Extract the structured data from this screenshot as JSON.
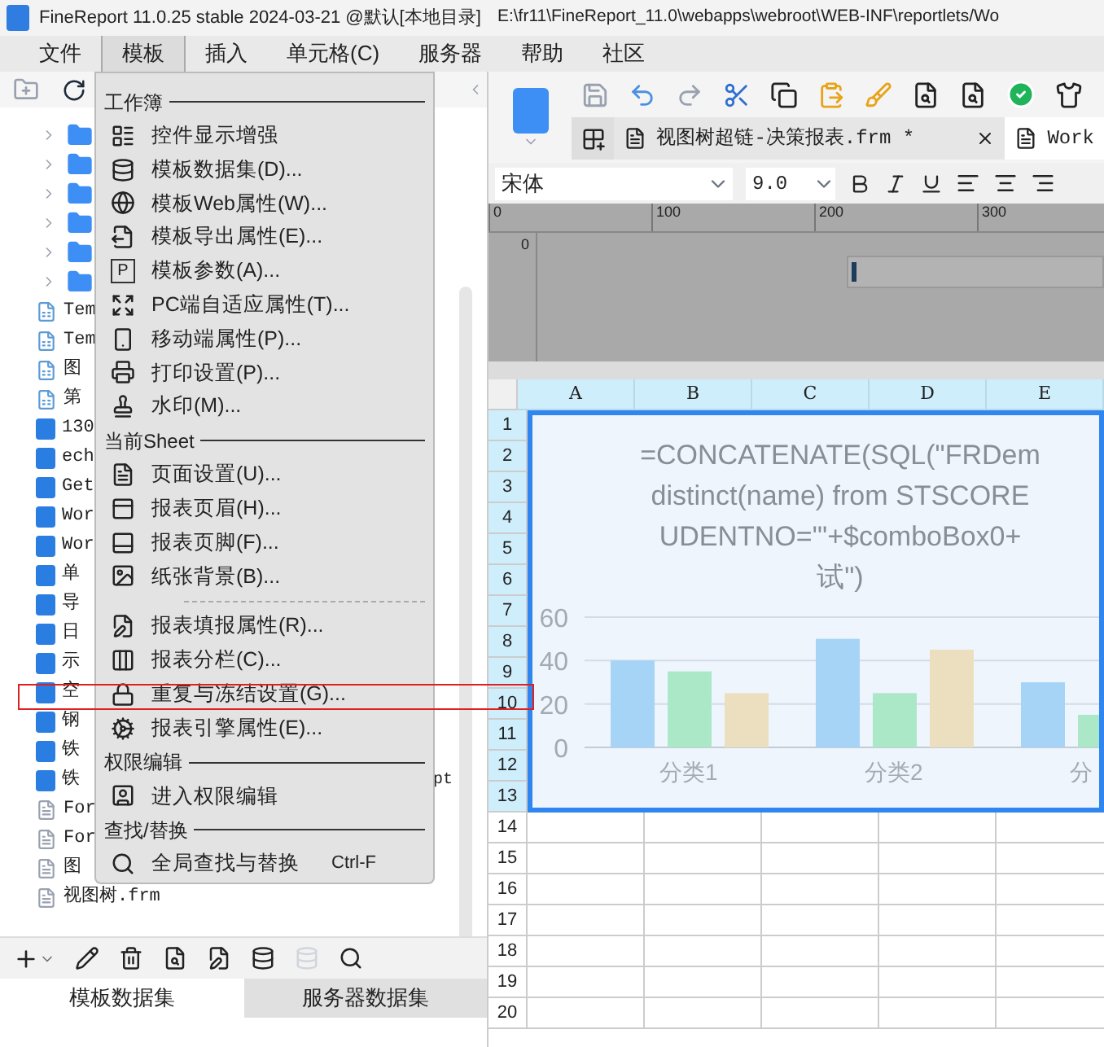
{
  "window": {
    "title": "FineReport 11.0.25 stable 2024-03-21 @默认[本地目录]",
    "path": "E:\\fr11\\FineReport_11.0\\webapps\\webroot\\WEB-INF\\reportlets/Wo"
  },
  "menubar": [
    {
      "label": "文件",
      "selected": false
    },
    {
      "label": "模板",
      "selected": true
    },
    {
      "label": "插入",
      "selected": false
    },
    {
      "label": "单元格(C)",
      "selected": false
    },
    {
      "label": "服务器",
      "selected": false
    },
    {
      "label": "帮助",
      "selected": false
    },
    {
      "label": "社区",
      "selected": false
    }
  ],
  "tree": [
    {
      "kind": "folder"
    },
    {
      "kind": "folder"
    },
    {
      "kind": "folder"
    },
    {
      "kind": "folder"
    },
    {
      "kind": "folder"
    },
    {
      "kind": "folder"
    },
    {
      "kind": "cpt",
      "label": "Tem"
    },
    {
      "kind": "cpt",
      "label": "Tem"
    },
    {
      "kind": "cpt",
      "label": "图"
    },
    {
      "kind": "cpt",
      "label": "第"
    },
    {
      "kind": "frm",
      "label": "130"
    },
    {
      "kind": "frm",
      "label": "ech"
    },
    {
      "kind": "frm",
      "label": "Get"
    },
    {
      "kind": "frm",
      "label": "Wor"
    },
    {
      "kind": "frm",
      "label": "Wor"
    },
    {
      "kind": "frm",
      "label": "单"
    },
    {
      "kind": "frm",
      "label": "导"
    },
    {
      "kind": "frm",
      "label": "日"
    },
    {
      "kind": "frm",
      "label": "示"
    },
    {
      "kind": "frm",
      "label": "空"
    },
    {
      "kind": "frm",
      "label": "钢"
    },
    {
      "kind": "frm",
      "label": "铁"
    },
    {
      "kind": "frm",
      "label": "铁",
      "tail": "pt"
    },
    {
      "kind": "form",
      "label": "For"
    },
    {
      "kind": "form",
      "label": "For"
    },
    {
      "kind": "form",
      "label": "图"
    },
    {
      "kind": "form",
      "label": "视图树.frm"
    }
  ],
  "dataset_tabs": [
    {
      "label": "模板数据集",
      "selected": true
    },
    {
      "label": "服务器数据集",
      "selected": false
    }
  ],
  "menu": [
    {
      "kind": "header",
      "label": "工作簿"
    },
    {
      "kind": "item",
      "label": "控件显示增强"
    },
    {
      "kind": "item",
      "label": "模板数据集(D)..."
    },
    {
      "kind": "item",
      "label": "模板Web属性(W)..."
    },
    {
      "kind": "item",
      "label": "模板导出属性(E)..."
    },
    {
      "kind": "item",
      "label": "模板参数(A)...",
      "glyph": "P"
    },
    {
      "kind": "item",
      "label": "PC端自适应属性(T)..."
    },
    {
      "kind": "item",
      "label": "移动端属性(P)..."
    },
    {
      "kind": "item",
      "label": "打印设置(P)..."
    },
    {
      "kind": "item",
      "label": "水印(M)..."
    },
    {
      "kind": "header",
      "label": "当前Sheet"
    },
    {
      "kind": "item",
      "label": "页面设置(U)..."
    },
    {
      "kind": "item",
      "label": "报表页眉(H)..."
    },
    {
      "kind": "item",
      "label": "报表页脚(F)..."
    },
    {
      "kind": "item",
      "label": "纸张背景(B)..."
    },
    {
      "kind": "separator"
    },
    {
      "kind": "item",
      "label": "报表填报属性(R)..."
    },
    {
      "kind": "item",
      "label": "报表分栏(C)..."
    },
    {
      "kind": "item",
      "label": "重复与冻结设置(G)...",
      "marked": true
    },
    {
      "kind": "item",
      "label": "报表引擎属性(E)..."
    },
    {
      "kind": "header",
      "label": "权限编辑"
    },
    {
      "kind": "item",
      "label": "进入权限编辑"
    },
    {
      "kind": "header",
      "label": "查找/替换"
    },
    {
      "kind": "item",
      "label": "全局查找与替换",
      "shortcut": "Ctrl-F"
    }
  ],
  "doc_tabs": [
    {
      "label": "视图树超链-决策报表.frm *",
      "selected": true
    },
    {
      "label": "Work",
      "selected": false
    }
  ],
  "font": {
    "family": "宋体",
    "size": "9.0"
  },
  "ruler": [
    "0",
    "100",
    "200",
    "300"
  ],
  "ruler_v": "0",
  "columns": [
    "A",
    "B",
    "C",
    "D",
    "E"
  ],
  "rows": [
    "1",
    "2",
    "3",
    "4",
    "5",
    "6",
    "7",
    "8",
    "9",
    "10",
    "11",
    "12",
    "13",
    "14",
    "15",
    "16",
    "17",
    "18",
    "19",
    "20"
  ],
  "chart": {
    "chart_data": {
      "type": "bar",
      "title": "=CONCATENATE(SQL(\"FRDem\ndistinct(name) from STSCORE\nUDENTNO='\"+$comboBox0+\n试\")",
      "categories": [
        "分类1",
        "分类2",
        "分"
      ],
      "series": [
        {
          "color": "#a6d4f7",
          "values": [
            40,
            50,
            30
          ]
        },
        {
          "color": "#abe8c8",
          "values": [
            35,
            25,
            15
          ]
        },
        {
          "color": "#ecdfbf",
          "values": [
            25,
            45,
            null
          ]
        }
      ],
      "ylim": [
        0,
        60
      ],
      "yticks": [
        0,
        20,
        40,
        60
      ]
    }
  }
}
